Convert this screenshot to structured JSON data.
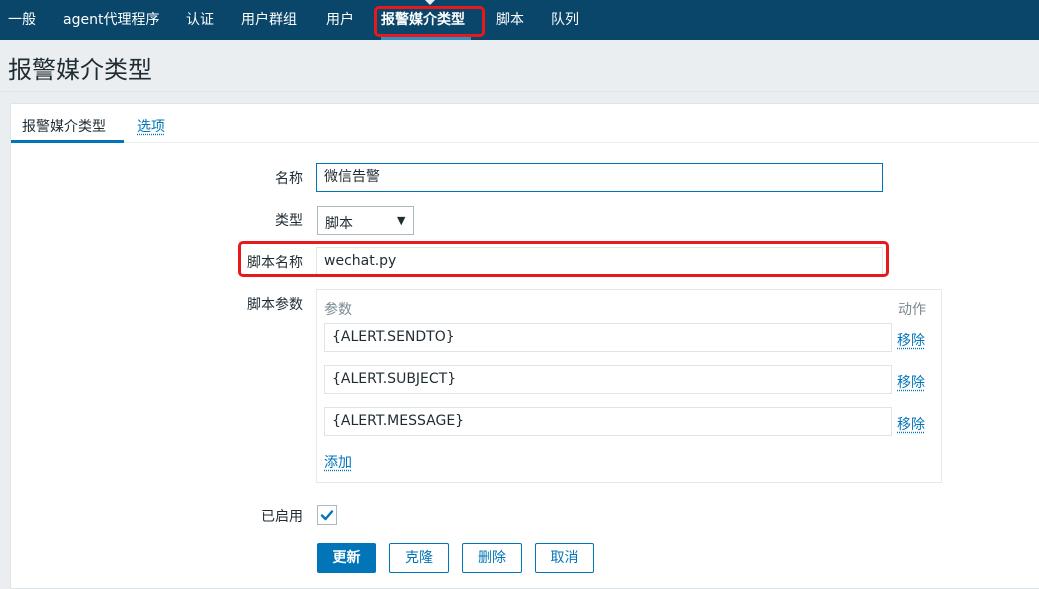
{
  "nav": {
    "items": [
      {
        "label": "一般"
      },
      {
        "label": "agent代理程序"
      },
      {
        "label": "认证"
      },
      {
        "label": "用户群组"
      },
      {
        "label": "用户"
      },
      {
        "label": "报警媒介类型",
        "active": true
      },
      {
        "label": "脚本"
      },
      {
        "label": "队列"
      }
    ]
  },
  "page": {
    "title": "报警媒介类型"
  },
  "tabs": [
    {
      "label": "报警媒介类型",
      "active": true
    },
    {
      "label": "选项"
    }
  ],
  "form": {
    "name_label": "名称",
    "name_value": "微信告警",
    "type_label": "类型",
    "type_value": "脚本",
    "script_name_label": "脚本名称",
    "script_name_value": "wechat.py",
    "script_params_label": "脚本参数",
    "params_header": "参数",
    "actions_header": "动作",
    "params": [
      {
        "value": "{ALERT.SENDTO}",
        "remove_label": "移除"
      },
      {
        "value": "{ALERT.SUBJECT}",
        "remove_label": "移除"
      },
      {
        "value": "{ALERT.MESSAGE}",
        "remove_label": "移除"
      }
    ],
    "add_label": "添加",
    "enabled_label": "已启用",
    "enabled": true
  },
  "buttons": {
    "update": "更新",
    "clone": "克隆",
    "delete": "删除",
    "cancel": "取消"
  },
  "colors": {
    "nav_bg": "#0a466a",
    "accent": "#0275b8",
    "highlight_box": "#e8181b"
  },
  "icons": {
    "dropdown": "triangle-down-icon",
    "checkbox": "checkmark-icon"
  }
}
